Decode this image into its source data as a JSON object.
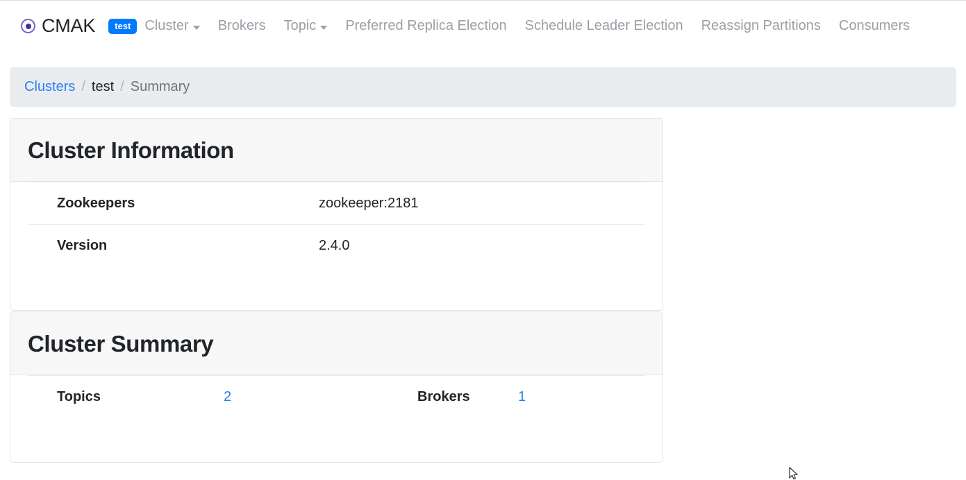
{
  "navbar": {
    "brand_name": "CMAK",
    "brand_logo_icon": "target-circle-icon",
    "cluster_badge": "test",
    "items": [
      {
        "label": "Cluster",
        "has_caret": true
      },
      {
        "label": "Brokers",
        "has_caret": false
      },
      {
        "label": "Topic",
        "has_caret": true
      },
      {
        "label": "Preferred Replica Election",
        "has_caret": false
      },
      {
        "label": "Schedule Leader Election",
        "has_caret": false
      },
      {
        "label": "Reassign Partitions",
        "has_caret": false
      },
      {
        "label": "Consumers",
        "has_caret": false
      }
    ]
  },
  "breadcrumb": {
    "clusters": "Clusters",
    "sep1": "/",
    "cluster_name": "test",
    "sep2": "/",
    "current": "Summary"
  },
  "cluster_information": {
    "title": "Cluster Information",
    "rows": [
      {
        "label": "Zookeepers",
        "value": "zookeeper:2181"
      },
      {
        "label": "Version",
        "value": "2.4.0"
      }
    ]
  },
  "cluster_summary": {
    "title": "Cluster Summary",
    "topics_label": "Topics",
    "topics_value": "2",
    "brokers_label": "Brokers",
    "brokers_value": "1"
  },
  "colors": {
    "link": "#2a7ef5",
    "badge_bg": "#007bff",
    "breadcrumb_bg": "#e9ecef",
    "card_header_bg": "#f7f7f7",
    "nav_text": "#9aa0a6",
    "logo_outer": "#6f66c4",
    "logo_inner": "#3b35a0"
  }
}
